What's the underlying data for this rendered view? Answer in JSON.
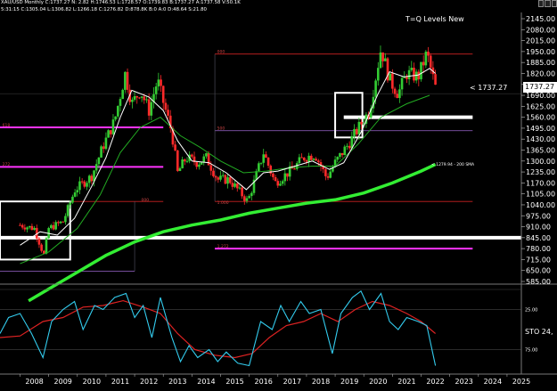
{
  "header": {
    "symbol_line": "XAU/USD Monthly C:1737.27 N: 2.82 H:1746.53 L:1728.57 O:1739.83 B:1737.27 A:1737.58 V:50.1K",
    "ma_line": "5:31:15 C:1305.04 L:1306.82 L:1266.18 C:1276.82 D:878.8K B:0 A:0 D:48.64 S:21.80",
    "title": "T=Q Levels New"
  },
  "price_label": {
    "left_text": "< 1737.27",
    "box_text": "1737.27"
  },
  "sma_label": "< 1279.94 - 200 SMA",
  "sto_label": "STO 24,",
  "colors": {
    "background": "#000000",
    "up_candle": "#33cc33",
    "down_candle": "#ff2a2a",
    "sma_200": "#33ee33",
    "sma_fast": "#ffffff",
    "sma_mid": "#22aa22",
    "magenta_level": "#ff33ff",
    "stoch_k": "#33ccee",
    "stoch_d": "#dd2222"
  },
  "chart_data": {
    "type": "candlestick",
    "title": "T=Q Levels New",
    "timeframe": "Monthly",
    "symbol": "XAU/USD",
    "x_ticks": [
      "2008",
      "2009",
      "2010",
      "2011",
      "2012",
      "2013",
      "2014",
      "2015",
      "2016",
      "2017",
      "2018",
      "2019",
      "2020",
      "2021",
      "2022",
      "2023",
      "2024",
      "2025"
    ],
    "y_ticks": [
      2145,
      2080,
      2015,
      1950,
      1885,
      1820,
      1755,
      1690,
      1625,
      1560,
      1495,
      1430,
      1365,
      1300,
      1235,
      1170,
      1105,
      1040,
      975,
      910,
      845,
      780,
      715,
      650,
      585
    ],
    "ylim": [
      585,
      2145
    ],
    "price_path": [
      [
        2008.0,
        920
      ],
      [
        2008.5,
        900
      ],
      [
        2008.83,
        740
      ],
      [
        2009.0,
        900
      ],
      [
        2009.5,
        940
      ],
      [
        2009.92,
        1130
      ],
      [
        2010.5,
        1210
      ],
      [
        2010.9,
        1390
      ],
      [
        2011.3,
        1540
      ],
      [
        2011.67,
        1820
      ],
      [
        2011.9,
        1640
      ],
      [
        2012.2,
        1720
      ],
      [
        2012.5,
        1600
      ],
      [
        2012.8,
        1780
      ],
      [
        2013.0,
        1650
      ],
      [
        2013.3,
        1470
      ],
      [
        2013.5,
        1230
      ],
      [
        2013.8,
        1320
      ],
      [
        2014.2,
        1290
      ],
      [
        2014.5,
        1320
      ],
      [
        2014.9,
        1190
      ],
      [
        2015.3,
        1190
      ],
      [
        2015.7,
        1110
      ],
      [
        2015.95,
        1060
      ],
      [
        2016.5,
        1350
      ],
      [
        2016.9,
        1170
      ],
      [
        2017.5,
        1250
      ],
      [
        2017.9,
        1320
      ],
      [
        2018.3,
        1340
      ],
      [
        2018.7,
        1200
      ],
      [
        2019.0,
        1290
      ],
      [
        2019.5,
        1410
      ],
      [
        2019.9,
        1520
      ],
      [
        2020.2,
        1600
      ],
      [
        2020.6,
        1970
      ],
      [
        2020.9,
        1780
      ],
      [
        2021.2,
        1700
      ],
      [
        2021.5,
        1820
      ],
      [
        2021.9,
        1800
      ],
      [
        2022.2,
        1940
      ],
      [
        2022.5,
        1737.27
      ]
    ],
    "sma_fast": [
      [
        2008.0,
        800
      ],
      [
        2008.7,
        880
      ],
      [
        2009.3,
        860
      ],
      [
        2009.9,
        960
      ],
      [
        2010.5,
        1150
      ],
      [
        2011.0,
        1320
      ],
      [
        2011.5,
        1560
      ],
      [
        2011.9,
        1720
      ],
      [
        2012.5,
        1680
      ],
      [
        2013.0,
        1600
      ],
      [
        2013.5,
        1420
      ],
      [
        2014.0,
        1300
      ],
      [
        2014.6,
        1290
      ],
      [
        2015.2,
        1230
      ],
      [
        2015.9,
        1130
      ],
      [
        2016.5,
        1230
      ],
      [
        2017.0,
        1240
      ],
      [
        2017.6,
        1270
      ],
      [
        2018.2,
        1300
      ],
      [
        2018.8,
        1250
      ],
      [
        2019.3,
        1290
      ],
      [
        2019.9,
        1470
      ],
      [
        2020.5,
        1700
      ],
      [
        2020.9,
        1830
      ],
      [
        2021.4,
        1800
      ],
      [
        2021.9,
        1810
      ],
      [
        2022.3,
        1850
      ],
      [
        2022.5,
        1820
      ]
    ],
    "sma_mid": [
      [
        2008.0,
        690
      ],
      [
        2009.0,
        760
      ],
      [
        2010.0,
        900
      ],
      [
        2010.8,
        1100
      ],
      [
        2011.5,
        1350
      ],
      [
        2012.2,
        1500
      ],
      [
        2012.9,
        1560
      ],
      [
        2013.6,
        1450
      ],
      [
        2014.3,
        1380
      ],
      [
        2015.0,
        1300
      ],
      [
        2015.8,
        1230
      ],
      [
        2016.6,
        1240
      ],
      [
        2017.4,
        1260
      ],
      [
        2018.2,
        1270
      ],
      [
        2019.0,
        1270
      ],
      [
        2019.8,
        1400
      ],
      [
        2020.6,
        1560
      ],
      [
        2021.5,
        1640
      ],
      [
        2022.3,
        1690
      ]
    ],
    "sma_200": [
      [
        2008.3,
        470
      ],
      [
        2009.0,
        540
      ],
      [
        2010.0,
        640
      ],
      [
        2011.0,
        740
      ],
      [
        2012.0,
        820
      ],
      [
        2013.0,
        880
      ],
      [
        2014.0,
        920
      ],
      [
        2015.0,
        950
      ],
      [
        2016.0,
        990
      ],
      [
        2017.0,
        1020
      ],
      [
        2018.0,
        1050
      ],
      [
        2019.0,
        1070
      ],
      [
        2020.0,
        1110
      ],
      [
        2021.0,
        1170
      ],
      [
        2022.0,
        1240
      ],
      [
        2022.5,
        1279.94
      ]
    ],
    "sma_200_last": 1279.94,
    "white_levels": [
      {
        "y": 845,
        "x_from": 2007.3,
        "x_to": 2025.5
      },
      {
        "y": 1560,
        "x_from": 2019.3,
        "x_to": 2023.8
      }
    ],
    "magenta_levels": [
      {
        "y": 1500,
        "x_from": 2007.3,
        "x_to": 2013.0
      },
      {
        "y": 1265,
        "x_from": 2007.3,
        "x_to": 2013.0
      },
      {
        "y": 780,
        "x_from": 2014.8,
        "x_to": 2023.8
      }
    ],
    "red_levels": [
      {
        "y": 1935,
        "x_from": 2014.8,
        "x_to": 2023.8
      },
      {
        "y": 1060,
        "x_from": 2014.8,
        "x_to": 2023.8
      },
      {
        "y": 1060,
        "x_from": 2009.0,
        "x_to": 2013.0
      }
    ],
    "purple_levels": [
      {
        "y": 1480,
        "x_from": 2014.8,
        "x_to": 2023.8
      },
      {
        "y": 645,
        "x_from": 2007.3,
        "x_to": 2012.0
      }
    ],
    "boxes": [
      {
        "x_from": 2007.3,
        "x_to": 2009.75,
        "y_from": 715,
        "y_to": 1060
      },
      {
        "x_from": 2019.0,
        "x_to": 2019.95,
        "y_from": 1440,
        "y_to": 1705
      }
    ],
    "fib_labels": [
      {
        "text": "618",
        "x": 2007.35,
        "y": 1505
      },
      {
        "text": "272",
        "x": 2007.35,
        "y": 1272
      },
      {
        "text": "000",
        "x": 2012.2,
        "y": 1062
      },
      {
        "text": "000",
        "x": 2014.85,
        "y": 1941
      },
      {
        "text": "500",
        "x": 2014.85,
        "y": 1486
      },
      {
        "text": "1.000",
        "x": 2014.85,
        "y": 1046
      },
      {
        "text": "1.272",
        "x": 2014.85,
        "y": 786
      }
    ],
    "sto_ticks": [
      "25.00",
      "75.00"
    ],
    "stoch_k": [
      [
        2007.3,
        55
      ],
      [
        2007.6,
        35
      ],
      [
        2008.0,
        30
      ],
      [
        2008.4,
        55
      ],
      [
        2008.8,
        85
      ],
      [
        2009.1,
        40
      ],
      [
        2009.5,
        25
      ],
      [
        2009.9,
        15
      ],
      [
        2010.2,
        50
      ],
      [
        2010.6,
        20
      ],
      [
        2010.9,
        25
      ],
      [
        2011.3,
        10
      ],
      [
        2011.7,
        5
      ],
      [
        2012.0,
        35
      ],
      [
        2012.3,
        20
      ],
      [
        2012.6,
        60
      ],
      [
        2012.9,
        10
      ],
      [
        2013.3,
        60
      ],
      [
        2013.6,
        90
      ],
      [
        2013.9,
        70
      ],
      [
        2014.2,
        85
      ],
      [
        2014.6,
        75
      ],
      [
        2014.9,
        90
      ],
      [
        2015.2,
        78
      ],
      [
        2015.6,
        92
      ],
      [
        2016.0,
        95
      ],
      [
        2016.4,
        40
      ],
      [
        2016.8,
        50
      ],
      [
        2017.1,
        20
      ],
      [
        2017.4,
        40
      ],
      [
        2017.8,
        15
      ],
      [
        2018.1,
        30
      ],
      [
        2018.5,
        25
      ],
      [
        2018.9,
        80
      ],
      [
        2019.2,
        30
      ],
      [
        2019.6,
        10
      ],
      [
        2019.9,
        2
      ],
      [
        2020.2,
        25
      ],
      [
        2020.6,
        5
      ],
      [
        2020.9,
        40
      ],
      [
        2021.2,
        50
      ],
      [
        2021.5,
        35
      ],
      [
        2021.9,
        40
      ],
      [
        2022.2,
        45
      ],
      [
        2022.5,
        95
      ]
    ],
    "stoch_d": [
      [
        2007.3,
        60
      ],
      [
        2008.0,
        58
      ],
      [
        2008.8,
        40
      ],
      [
        2009.5,
        35
      ],
      [
        2010.2,
        22
      ],
      [
        2010.9,
        20
      ],
      [
        2011.6,
        14
      ],
      [
        2012.3,
        22
      ],
      [
        2012.9,
        30
      ],
      [
        2013.5,
        55
      ],
      [
        2014.1,
        75
      ],
      [
        2014.8,
        82
      ],
      [
        2015.5,
        85
      ],
      [
        2016.1,
        80
      ],
      [
        2016.7,
        60
      ],
      [
        2017.3,
        45
      ],
      [
        2017.9,
        40
      ],
      [
        2018.5,
        30
      ],
      [
        2019.1,
        40
      ],
      [
        2019.7,
        25
      ],
      [
        2020.3,
        15
      ],
      [
        2020.9,
        20
      ],
      [
        2021.5,
        30
      ],
      [
        2022.0,
        40
      ],
      [
        2022.5,
        55
      ]
    ]
  }
}
